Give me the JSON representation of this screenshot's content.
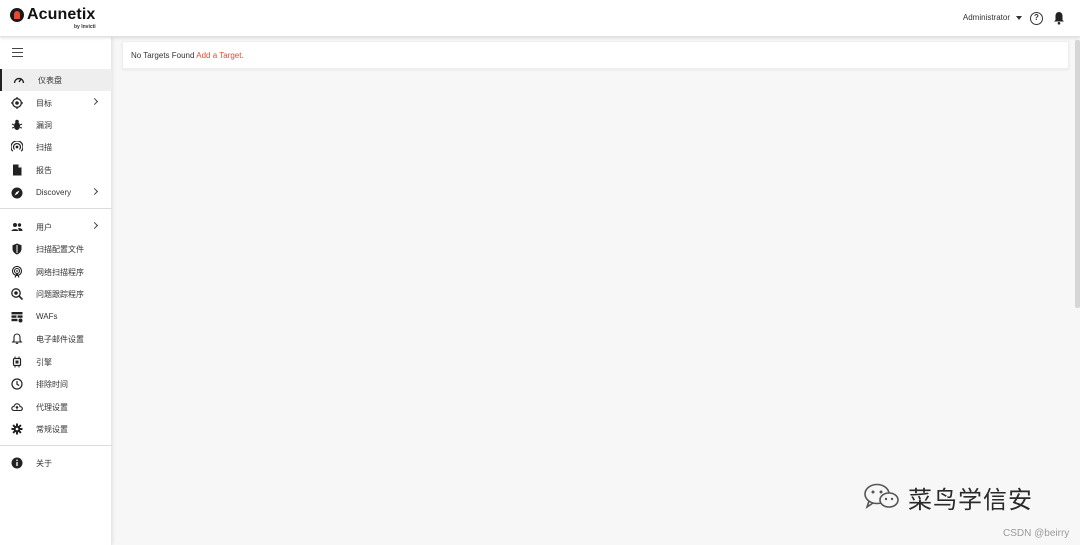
{
  "header": {
    "logo_text": "Acunetix",
    "logo_sub": "by Invicti",
    "user_label": "Administrator"
  },
  "sidebar": {
    "items": [
      {
        "label": "仪表盘",
        "icon": "gauge-icon",
        "active": true
      },
      {
        "label": "目标",
        "icon": "target-icon",
        "has_children": true
      },
      {
        "label": "漏洞",
        "icon": "bug-icon"
      },
      {
        "label": "扫描",
        "icon": "radar-icon"
      },
      {
        "label": "报告",
        "icon": "document-icon"
      },
      {
        "label": "Discovery",
        "icon": "compass-icon",
        "has_children": true
      },
      {
        "label": "用户",
        "icon": "users-icon",
        "has_children": true
      },
      {
        "label": "扫描配置文件",
        "icon": "shield-icon"
      },
      {
        "label": "网络扫描程序",
        "icon": "network-scanner-icon"
      },
      {
        "label": "问题跟踪程序",
        "icon": "issue-tracker-icon"
      },
      {
        "label": "WAFs",
        "icon": "firewall-icon"
      },
      {
        "label": "电子邮件设置",
        "icon": "bell-outline-icon"
      },
      {
        "label": "引擎",
        "icon": "chip-icon"
      },
      {
        "label": "排除时间",
        "icon": "clock-icon"
      },
      {
        "label": "代理设置",
        "icon": "cloud-upload-icon"
      },
      {
        "label": "常规设置",
        "icon": "gear-icon"
      },
      {
        "label": "关于",
        "icon": "info-icon"
      }
    ]
  },
  "main": {
    "empty_text": "No Targets Found ",
    "add_link": "Add a Target.",
    "separator_char": "."
  },
  "watermark": {
    "text": "菜鸟学信安",
    "credit": "CSDN @beirry"
  },
  "colors": {
    "accent": "#e84a2f",
    "sidebar_bg": "#ffffff",
    "content_bg": "#f7f7f7"
  }
}
